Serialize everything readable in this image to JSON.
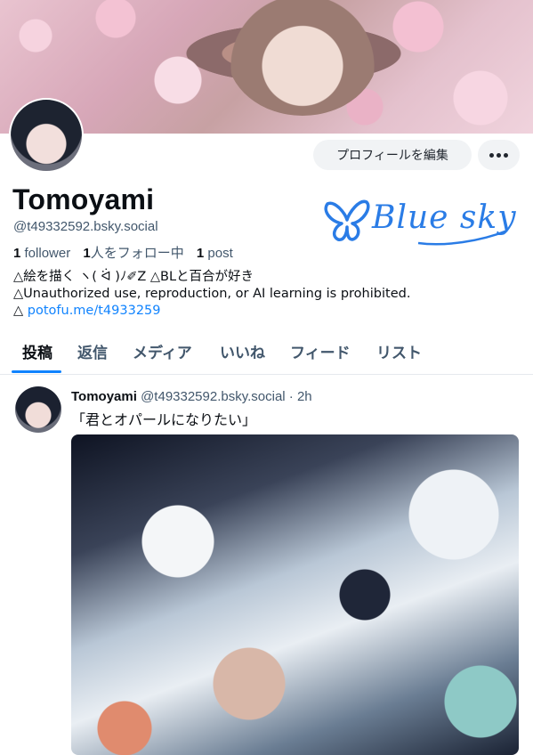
{
  "profile": {
    "display_name": "Tomoyami",
    "handle": "@t49332592.bsky.social",
    "followers_count": "1",
    "followers_label": "follower",
    "following_count": "1",
    "following_label": "人をフォロー中",
    "posts_count": "1",
    "posts_label": "post",
    "bio_line1": "△絵を描く ︎ヽ( ᐛ )ﾉ✐Z △BLと百合が好き",
    "bio_line2": "△Unauthorized use, reproduction, or AI learning is prohibited.",
    "bio_line3_prefix": "△ ",
    "bio_link": "potofu.me/t4933259",
    "logo_text": "Blue sky"
  },
  "actions": {
    "edit_profile": "プロフィールを編集",
    "more": "more"
  },
  "tabs": [
    {
      "label": "投稿"
    },
    {
      "label": "返信"
    },
    {
      "label": "メディア"
    },
    {
      "label": "いいね"
    },
    {
      "label": "フィード"
    },
    {
      "label": "リスト"
    }
  ],
  "post": {
    "author": "Tomoyami",
    "handle": "@t49332592.bsky.social",
    "separator": " · ",
    "time": "2h",
    "text": "「君とオパールになりたい」"
  },
  "colors": {
    "accent": "#1083fe",
    "muted": "#42576c",
    "button_bg": "#f1f3f5"
  }
}
